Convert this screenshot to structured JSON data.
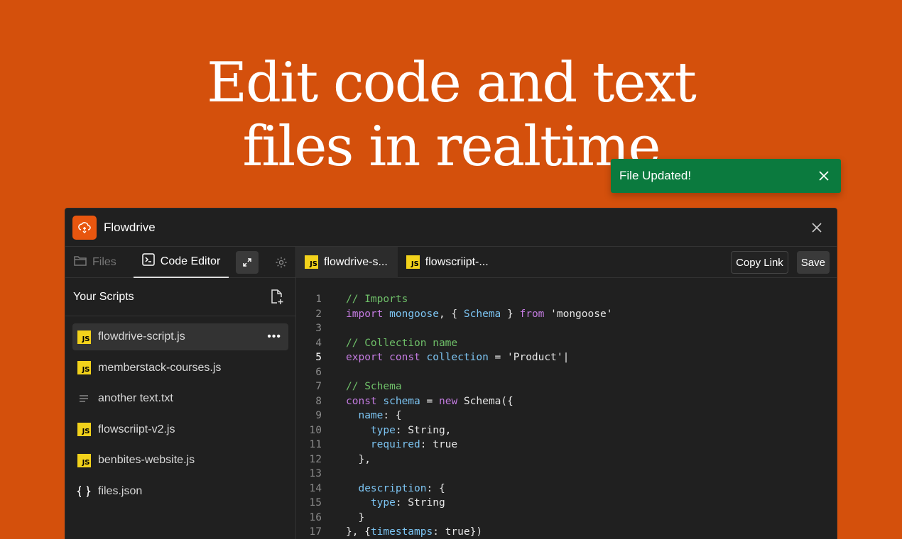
{
  "headline": {
    "line1": "Edit code and text",
    "line2": "files in realtime"
  },
  "toast": {
    "message": "File Updated!",
    "close_icon": "close-icon"
  },
  "window": {
    "app_name": "Flowdrive",
    "sidebar": {
      "tabs": [
        {
          "label": "Files",
          "icon": "folder-icon"
        },
        {
          "label": "Code Editor",
          "icon": "terminal-icon"
        }
      ],
      "scripts_title": "Your Scripts",
      "files": [
        {
          "name": "flowdrive-script.js",
          "icon": "js",
          "selected": true,
          "more": "•••"
        },
        {
          "name": "memberstack-courses.js",
          "icon": "js"
        },
        {
          "name": "another text.txt",
          "icon": "text"
        },
        {
          "name": "flowscriipt-v2.js",
          "icon": "js"
        },
        {
          "name": "benbites-website.js",
          "icon": "js"
        },
        {
          "name": "files.json",
          "icon": "json"
        }
      ]
    },
    "editor": {
      "tabs": [
        {
          "label": "flowdrive-s...",
          "active": true
        },
        {
          "label": "flowscriipt-..."
        }
      ],
      "copy_link_label": "Copy Link",
      "save_label": "Save",
      "current_line": 5,
      "lines": [
        [
          [
            "c",
            "// Imports"
          ]
        ],
        [
          [
            "k",
            "import"
          ],
          [
            "p",
            " "
          ],
          [
            "i",
            "mongoose"
          ],
          [
            "p",
            ", { "
          ],
          [
            "i",
            "Schema"
          ],
          [
            "p",
            " } "
          ],
          [
            "k",
            "from"
          ],
          [
            "p",
            " 'mongoose'"
          ]
        ],
        [],
        [
          [
            "c",
            "// Collection name"
          ]
        ],
        [
          [
            "k",
            "export"
          ],
          [
            "p",
            " "
          ],
          [
            "k",
            "const"
          ],
          [
            "p",
            " "
          ],
          [
            "i",
            "collection"
          ],
          [
            "p",
            " = 'Product'|"
          ]
        ],
        [],
        [
          [
            "c",
            "// Schema"
          ]
        ],
        [
          [
            "k",
            "const"
          ],
          [
            "p",
            " "
          ],
          [
            "i",
            "schema"
          ],
          [
            "p",
            " = "
          ],
          [
            "k",
            "new"
          ],
          [
            "p",
            " Schema({"
          ]
        ],
        [
          [
            "p",
            "  "
          ],
          [
            "i",
            "name"
          ],
          [
            "p",
            ": {"
          ]
        ],
        [
          [
            "p",
            "    "
          ],
          [
            "i",
            "type"
          ],
          [
            "p",
            ": String,"
          ]
        ],
        [
          [
            "p",
            "    "
          ],
          [
            "i",
            "required"
          ],
          [
            "p",
            ": true"
          ]
        ],
        [
          [
            "p",
            "  },"
          ]
        ],
        [],
        [
          [
            "p",
            "  "
          ],
          [
            "i",
            "description"
          ],
          [
            "p",
            ": {"
          ]
        ],
        [
          [
            "p",
            "    "
          ],
          [
            "i",
            "type"
          ],
          [
            "p",
            ": String"
          ]
        ],
        [
          [
            "p",
            "  }"
          ]
        ],
        [
          [
            "p",
            "}, {"
          ],
          [
            "i",
            "timestamps"
          ],
          [
            "p",
            ": true})"
          ]
        ]
      ]
    }
  }
}
